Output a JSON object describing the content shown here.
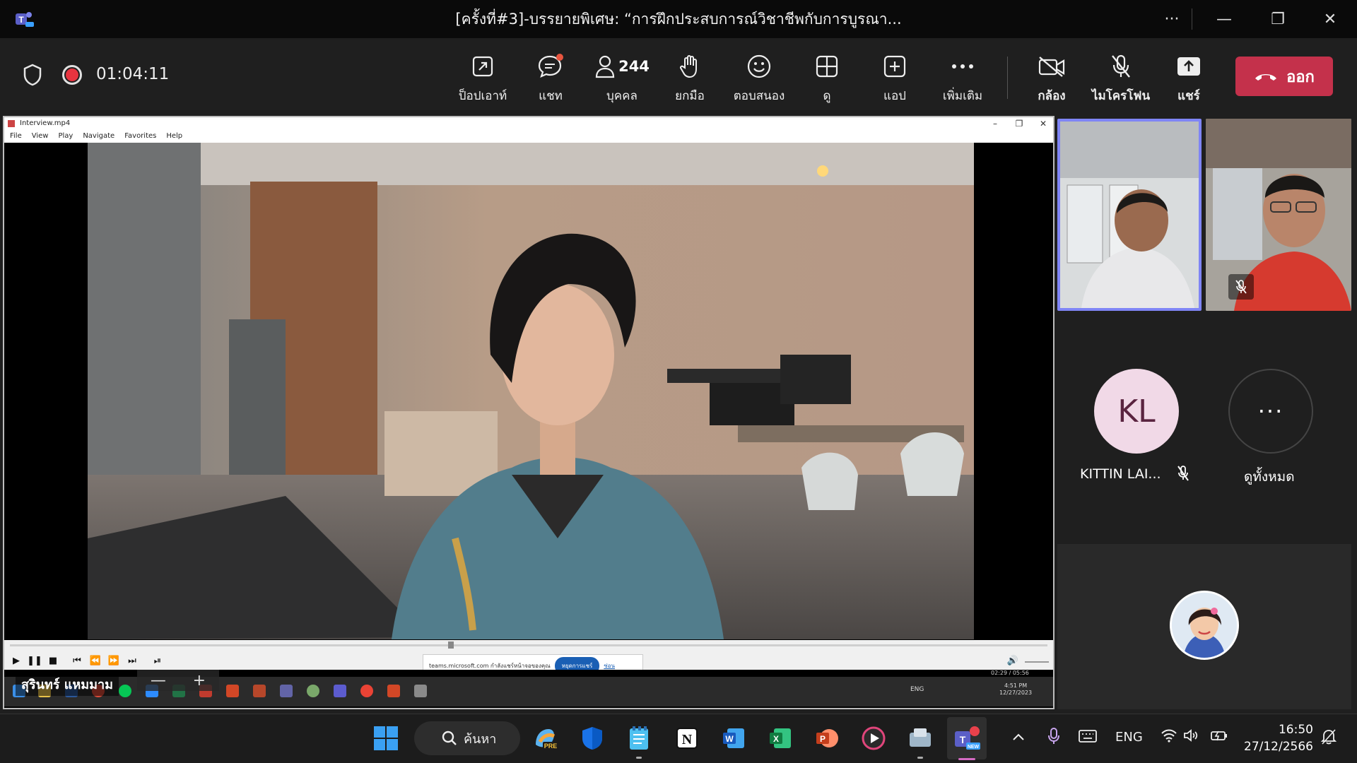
{
  "window": {
    "title": "[ครั้งที่#3]-บรรยายพิเศษ: “การฝึกประสบการณ์วิชาชีพกับการบูรณา...",
    "more": "···",
    "minimize": "—",
    "restore": "❐",
    "close": "✕"
  },
  "meeting": {
    "timer": "01:04:11",
    "tools": {
      "popout": "ป็อปเอาท์",
      "chat": "แชท",
      "people": "บุคคล",
      "people_count": "244",
      "raise_hand": "ยกมือ",
      "react": "ตอบสนอง",
      "view": "ดู",
      "apps": "แอป",
      "more": "เพิ่มเติม",
      "camera": "กล้อง",
      "mic": "ไมโครโฟน",
      "share": "แชร์"
    },
    "leave_label": "ออก",
    "accent_color": "#c4314b"
  },
  "shared_screen": {
    "player_title": "Interview.mp4",
    "menu": [
      "File",
      "View",
      "Play",
      "Navigate",
      "Favorites",
      "Help"
    ],
    "presenter_name": "สุรินทร์ แหมมาม",
    "notice_text": "teams.microsoft.com กำลังแชร์หน้าจอของคุณ",
    "notice_stop": "หยุดการแชร์",
    "notice_hide": "ซ่อน",
    "playback_time": "02:29 / 05:56",
    "inner_clock_time": "4:51 PM",
    "inner_clock_date": "12/27/2023",
    "inner_lang": "ENG"
  },
  "participants": {
    "kl_initials": "KL",
    "kl_name": "KITTIN LAI...",
    "view_all": "ดูทั้งหมด",
    "view_all_icon": "···",
    "highlight_color": "#7f85f5"
  },
  "taskbar": {
    "search_label": "ค้นหา",
    "lang": "ENG",
    "time": "16:50",
    "date": "27/12/2566"
  }
}
